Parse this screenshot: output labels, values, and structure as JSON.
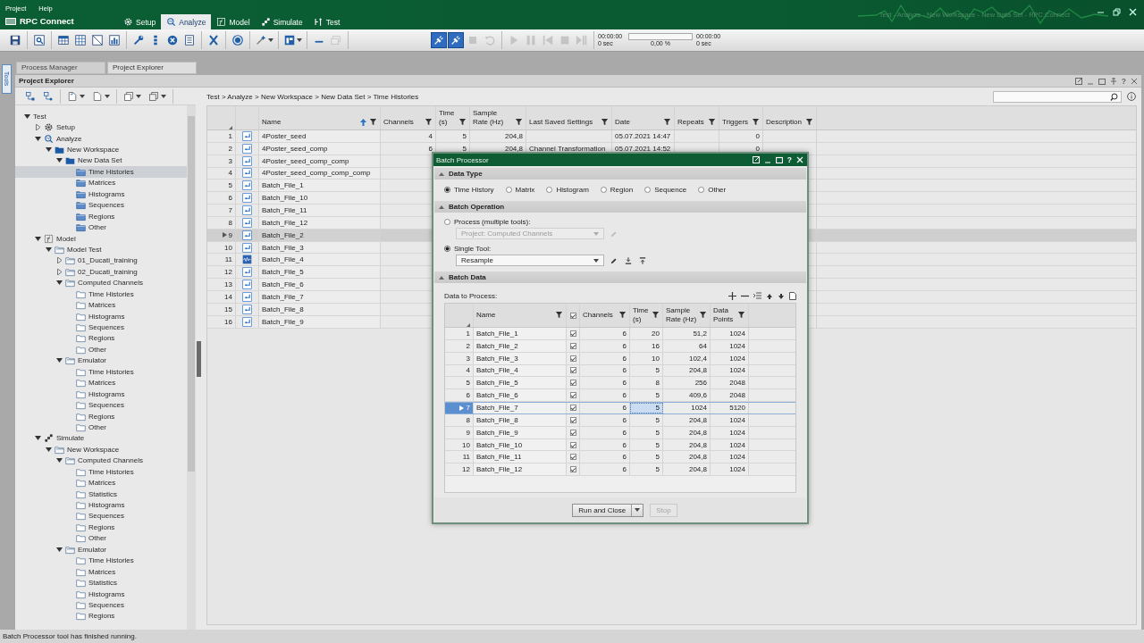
{
  "titlebar": {
    "menus": [
      "Project",
      "Help"
    ],
    "app_name": "RPC Connect",
    "title": "Test - Analyze - New Workspace - New Data Set - RPC Connect",
    "nav_tabs": [
      {
        "label": "Setup",
        "kind": "gear",
        "selected": false
      },
      {
        "label": "Analyze",
        "kind": "analyze",
        "selected": true
      },
      {
        "label": "Model",
        "kind": "model",
        "selected": false
      },
      {
        "label": "Simulate",
        "kind": "simulate",
        "selected": false
      },
      {
        "label": "Test",
        "kind": "test",
        "selected": false
      }
    ]
  },
  "toolbar": {
    "tools": [
      [
        {
          "kind": "save",
          "pressed": false,
          "disabled": false,
          "menu": false
        }
      ],
      [
        {
          "kind": "preview",
          "pressed": false,
          "disabled": false,
          "menu": false
        }
      ],
      [
        {
          "kind": "grid",
          "pressed": false,
          "disabled": false,
          "menu": false
        },
        {
          "kind": "matrix",
          "pressed": false,
          "disabled": false,
          "menu": false
        },
        {
          "kind": "frame",
          "pressed": false,
          "disabled": false,
          "menu": false
        },
        {
          "kind": "chart",
          "pressed": false,
          "disabled": false,
          "menu": false
        }
      ],
      [
        {
          "kind": "wrench",
          "pressed": false,
          "disabled": false,
          "menu": false
        },
        {
          "kind": "pin",
          "pressed": false,
          "disabled": false,
          "menu": false
        },
        {
          "kind": "cancel",
          "pressed": false,
          "disabled": false,
          "menu": false
        },
        {
          "kind": "list",
          "pressed": false,
          "disabled": false,
          "menu": false
        }
      ],
      [
        {
          "kind": "variable",
          "pressed": false,
          "disabled": false,
          "menu": false
        }
      ],
      [
        {
          "kind": "target",
          "pressed": false,
          "disabled": false,
          "menu": false
        }
      ],
      [
        {
          "kind": "wand",
          "pressed": false,
          "disabled": false,
          "menu": true
        }
      ],
      [
        {
          "kind": "layout",
          "pressed": false,
          "disabled": false,
          "menu": true
        }
      ],
      [
        {
          "kind": "minus",
          "pressed": false,
          "disabled": false,
          "menu": false
        },
        {
          "kind": "window",
          "pressed": false,
          "disabled": true,
          "menu": false
        }
      ]
    ],
    "transport": [
      [
        {
          "kind": "plug",
          "pressed": true,
          "disabled": false,
          "menu": false
        },
        {
          "kind": "plug",
          "pressed": true,
          "disabled": false,
          "menu": false
        },
        {
          "kind": "square",
          "pressed": false,
          "disabled": true,
          "menu": false
        },
        {
          "kind": "undo",
          "pressed": false,
          "disabled": true,
          "menu": false
        }
      ],
      [
        {
          "kind": "play",
          "pressed": false,
          "disabled": true,
          "menu": false
        },
        {
          "kind": "pause",
          "pressed": false,
          "disabled": true,
          "menu": false
        },
        {
          "kind": "skip-back",
          "pressed": false,
          "disabled": true,
          "menu": false
        },
        {
          "kind": "stop",
          "pressed": false,
          "disabled": true,
          "menu": false
        },
        {
          "kind": "skip-end",
          "pressed": false,
          "disabled": true,
          "menu": false
        }
      ]
    ],
    "clock": {
      "start_time": "00:00:00",
      "start_sec": "0 sec",
      "percent": "0,00 %",
      "level": 0,
      "end_time": "00:00:00",
      "end_sec": "0 sec"
    }
  },
  "side_tab": {
    "label": "Tools"
  },
  "panel_tabs": [
    {
      "label": "Process Manager",
      "selected": false
    },
    {
      "label": "Project Explorer",
      "selected": true
    }
  ],
  "panel": {
    "title": "Project Explorer",
    "help": "?"
  },
  "explorer": {
    "toolbar": [
      [
        {
          "kind": "tree-add",
          "menu": false
        },
        {
          "kind": "tree-link",
          "menu": false
        }
      ],
      [
        {
          "kind": "doc-new",
          "menu": true
        },
        {
          "kind": "doc",
          "menu": true
        }
      ],
      [
        {
          "kind": "copy",
          "menu": true
        },
        {
          "kind": "copy-outline",
          "menu": true
        }
      ]
    ],
    "tree": [
      {
        "label": "Test",
        "kind": "none",
        "expanded": true,
        "selected": false,
        "children": [
          {
            "label": "Setup",
            "kind": "gear",
            "expanded": false,
            "selected": false
          },
          {
            "label": "Analyze",
            "kind": "analyze",
            "expanded": true,
            "selected": false,
            "children": [
              {
                "label": "New Workspace",
                "kind": "folder-filled",
                "expanded": true,
                "selected": false,
                "children": [
                  {
                    "label": "New Data Set",
                    "kind": "folder-filled",
                    "expanded": true,
                    "selected": false,
                    "children": [
                      {
                        "label": "Time Histories",
                        "kind": "folder-blue",
                        "selected": true
                      },
                      {
                        "label": "Matrices",
                        "kind": "folder-blue",
                        "selected": false
                      },
                      {
                        "label": "Histograms",
                        "kind": "folder-blue",
                        "selected": false
                      },
                      {
                        "label": "Sequences",
                        "kind": "folder-blue",
                        "selected": false
                      },
                      {
                        "label": "Regions",
                        "kind": "folder-blue",
                        "selected": false
                      },
                      {
                        "label": "Other",
                        "kind": "folder-blue",
                        "selected": false
                      }
                    ]
                  }
                ]
              }
            ]
          },
          {
            "label": "Model",
            "kind": "model",
            "expanded": true,
            "selected": false,
            "children": [
              {
                "label": "Model Test",
                "kind": "folder",
                "expanded": true,
                "selected": false,
                "children": [
                  {
                    "label": "01_Ducati_training",
                    "kind": "folder",
                    "expanded": false,
                    "selected": false
                  },
                  {
                    "label": "02_Ducati_training",
                    "kind": "folder",
                    "expanded": false,
                    "selected": false
                  },
                  {
                    "label": "Computed Channels",
                    "kind": "folder",
                    "expanded": true,
                    "selected": false,
                    "children": [
                      {
                        "label": "Time Histories",
                        "kind": "folder-outline",
                        "selected": false
                      },
                      {
                        "label": "Matrices",
                        "kind": "folder-outline",
                        "selected": false
                      },
                      {
                        "label": "Histograms",
                        "kind": "folder-outline",
                        "selected": false
                      },
                      {
                        "label": "Sequences",
                        "kind": "folder-outline",
                        "selected": false
                      },
                      {
                        "label": "Regions",
                        "kind": "folder-outline",
                        "selected": false
                      },
                      {
                        "label": "Other",
                        "kind": "folder-outline",
                        "selected": false
                      }
                    ]
                  },
                  {
                    "label": "Emulator",
                    "kind": "folder",
                    "expanded": true,
                    "selected": false,
                    "children": [
                      {
                        "label": "Time Histories",
                        "kind": "folder-outline",
                        "selected": false
                      },
                      {
                        "label": "Matrices",
                        "kind": "folder-outline",
                        "selected": false
                      },
                      {
                        "label": "Histograms",
                        "kind": "folder-outline",
                        "selected": false
                      },
                      {
                        "label": "Sequences",
                        "kind": "folder-outline",
                        "selected": false
                      },
                      {
                        "label": "Regions",
                        "kind": "folder-outline",
                        "selected": false
                      },
                      {
                        "label": "Other",
                        "kind": "folder-outline",
                        "selected": false
                      }
                    ]
                  }
                ]
              }
            ]
          },
          {
            "label": "Simulate",
            "kind": "simulate",
            "expanded": true,
            "selected": false,
            "children": [
              {
                "label": "New Workspace",
                "kind": "folder",
                "expanded": true,
                "selected": false,
                "children": [
                  {
                    "label": "Computed Channels",
                    "kind": "folder",
                    "expanded": true,
                    "selected": false,
                    "children": [
                      {
                        "label": "Time Histories",
                        "kind": "folder-outline",
                        "selected": false
                      },
                      {
                        "label": "Matrices",
                        "kind": "folder-outline",
                        "selected": false
                      },
                      {
                        "label": "Statistics",
                        "kind": "folder-outline",
                        "selected": false
                      },
                      {
                        "label": "Histograms",
                        "kind": "folder-outline",
                        "selected": false
                      },
                      {
                        "label": "Sequences",
                        "kind": "folder-outline",
                        "selected": false
                      },
                      {
                        "label": "Regions",
                        "kind": "folder-outline",
                        "selected": false
                      },
                      {
                        "label": "Other",
                        "kind": "folder-outline",
                        "selected": false
                      }
                    ]
                  },
                  {
                    "label": "Emulator",
                    "kind": "folder",
                    "expanded": true,
                    "selected": false,
                    "children": [
                      {
                        "label": "Time Histories",
                        "kind": "folder-outline",
                        "selected": false
                      },
                      {
                        "label": "Matrices",
                        "kind": "folder-outline",
                        "selected": false
                      },
                      {
                        "label": "Statistics",
                        "kind": "folder-outline",
                        "selected": false
                      },
                      {
                        "label": "Histograms",
                        "kind": "folder-outline",
                        "selected": false
                      },
                      {
                        "label": "Sequences",
                        "kind": "folder-outline",
                        "selected": false
                      },
                      {
                        "label": "Regions",
                        "kind": "folder-outline",
                        "selected": false
                      }
                    ]
                  }
                ]
              }
            ]
          }
        ]
      }
    ]
  },
  "breadcrumb": "Test > Analyze > New Workspace > New Data Set > Time Histories",
  "table": {
    "columns": [
      {
        "lines": [
          "Name"
        ],
        "sorted": true
      },
      {
        "lines": [
          "Channels"
        ],
        "sorted": false
      },
      {
        "lines": [
          "Time",
          "(s)"
        ],
        "sorted": false
      },
      {
        "lines": [
          "Sample",
          "Rate (Hz)"
        ],
        "sorted": false
      },
      {
        "lines": [
          "Last Saved Settings"
        ],
        "sorted": false
      },
      {
        "lines": [
          "Date"
        ],
        "sorted": false
      },
      {
        "lines": [
          "Repeats"
        ],
        "sorted": false
      },
      {
        "lines": [
          "Triggers"
        ],
        "sorted": false
      },
      {
        "lines": [
          "Description"
        ],
        "sorted": false
      }
    ],
    "rows": [
      {
        "number": "1",
        "kind": "file",
        "name": "4Poster_seed",
        "selected": false,
        "channels": "4",
        "time": "5",
        "sample_rate": "204,8",
        "date": "05.07.2021 14:47",
        "triggers": "0"
      },
      {
        "number": "2",
        "kind": "file",
        "name": "4Poster_seed_comp",
        "selected": false,
        "channels": "6",
        "time": "5",
        "sample_rate": "204,8",
        "last_saved_settings": "Channel Transformation",
        "date": "05.07.2021 14:52",
        "triggers": "0"
      },
      {
        "number": "3",
        "kind": "file",
        "name": "4Poster_seed_comp_comp",
        "selected": false
      },
      {
        "number": "4",
        "kind": "file",
        "name": "4Poster_seed_comp_comp_comp",
        "selected": false
      },
      {
        "number": "5",
        "kind": "file",
        "name": "Batch_File_1",
        "selected": false
      },
      {
        "number": "6",
        "kind": "file",
        "name": "Batch_File_10",
        "selected": false
      },
      {
        "number": "7",
        "kind": "file",
        "name": "Batch_File_11",
        "selected": false
      },
      {
        "number": "8",
        "kind": "file",
        "name": "Batch_File_12",
        "selected": false
      },
      {
        "number": "9",
        "kind": "file",
        "name": "Batch_File_2",
        "selected": true
      },
      {
        "number": "10",
        "kind": "file",
        "name": "Batch_File_3",
        "selected": false
      },
      {
        "number": "11",
        "kind": "wave",
        "name": "Batch_File_4",
        "selected": false
      },
      {
        "number": "12",
        "kind": "file",
        "name": "Batch_File_5",
        "selected": false
      },
      {
        "number": "13",
        "kind": "file",
        "name": "Batch_File_6",
        "selected": false
      },
      {
        "number": "14",
        "kind": "file",
        "name": "Batch_File_7",
        "selected": false
      },
      {
        "number": "15",
        "kind": "file",
        "name": "Batch_File_8",
        "selected": false
      },
      {
        "number": "16",
        "kind": "file",
        "name": "Batch_File_9",
        "selected": false
      }
    ]
  },
  "batch_processor": {
    "title": "Batch Processor",
    "help": "?",
    "data_type": {
      "title": "Data Type",
      "expanded": true,
      "options": [
        {
          "label": "Time History",
          "selected": true
        },
        {
          "label": "Matrix",
          "selected": false
        },
        {
          "label": "Histogram",
          "selected": false
        },
        {
          "label": "Region",
          "selected": false
        },
        {
          "label": "Sequence",
          "selected": false
        },
        {
          "label": "Other",
          "selected": false
        }
      ]
    },
    "batch_operation": {
      "title": "Batch Operation",
      "expanded": true,
      "options": [
        {
          "label": "Process (multiple tools):",
          "selected": false,
          "value": "Project: Computed Channels",
          "disabled": true
        },
        {
          "label": "Single Tool:",
          "selected": true,
          "value": "Resample",
          "disabled": false
        }
      ]
    },
    "batch_data": {
      "title": "Batch Data",
      "expanded": true,
      "label": "Data to Process:",
      "all_checked": true,
      "columns": [
        {
          "lines": [
            "Name"
          ]
        },
        {
          "lines": [
            "Channels"
          ]
        },
        {
          "lines": [
            "Time",
            "(s)"
          ]
        },
        {
          "lines": [
            "Sample",
            "Rate (Hz)"
          ]
        },
        {
          "lines": [
            "Data",
            "Points"
          ]
        }
      ],
      "rows": [
        {
          "number": "1",
          "name": "Batch_File_1",
          "checked": true,
          "channels": "6",
          "time": "20",
          "sample_rate": "51,2",
          "data_points": "1024",
          "selected": false
        },
        {
          "number": "2",
          "name": "Batch_File_2",
          "checked": true,
          "channels": "6",
          "time": "16",
          "sample_rate": "64",
          "data_points": "1024",
          "selected": false
        },
        {
          "number": "3",
          "name": "Batch_File_3",
          "checked": true,
          "channels": "6",
          "time": "10",
          "sample_rate": "102,4",
          "data_points": "1024",
          "selected": false
        },
        {
          "number": "4",
          "name": "Batch_File_4",
          "checked": true,
          "channels": "6",
          "time": "5",
          "sample_rate": "204,8",
          "data_points": "1024",
          "selected": false
        },
        {
          "number": "5",
          "name": "Batch_File_5",
          "checked": true,
          "channels": "6",
          "time": "8",
          "sample_rate": "256",
          "data_points": "2048",
          "selected": false
        },
        {
          "number": "6",
          "name": "Batch_File_6",
          "checked": true,
          "channels": "6",
          "time": "5",
          "sample_rate": "409,6",
          "data_points": "2048",
          "selected": false
        },
        {
          "number": "7",
          "name": "Batch_File_7",
          "checked": true,
          "channels": "6",
          "time": "5",
          "sample_rate": "1024",
          "data_points": "5120",
          "selected": true
        },
        {
          "number": "8",
          "name": "Batch_File_8",
          "checked": true,
          "channels": "6",
          "time": "5",
          "sample_rate": "204,8",
          "data_points": "1024",
          "selected": false
        },
        {
          "number": "9",
          "name": "Batch_File_9",
          "checked": true,
          "channels": "6",
          "time": "5",
          "sample_rate": "204,8",
          "data_points": "1024",
          "selected": false
        },
        {
          "number": "10",
          "name": "Batch_File_10",
          "checked": true,
          "channels": "6",
          "time": "5",
          "sample_rate": "204,8",
          "data_points": "1024",
          "selected": false
        },
        {
          "number": "11",
          "name": "Batch_File_11",
          "checked": true,
          "channels": "6",
          "time": "5",
          "sample_rate": "204,8",
          "data_points": "1024",
          "selected": false
        },
        {
          "number": "12",
          "name": "Batch_File_12",
          "checked": true,
          "channels": "6",
          "time": "5",
          "sample_rate": "204,8",
          "data_points": "1024",
          "selected": false
        }
      ]
    },
    "run_button": "Run and Close",
    "stop_button": {
      "label": "Stop",
      "disabled": true
    }
  },
  "status_bar": "Batch Processor tool has finished running."
}
